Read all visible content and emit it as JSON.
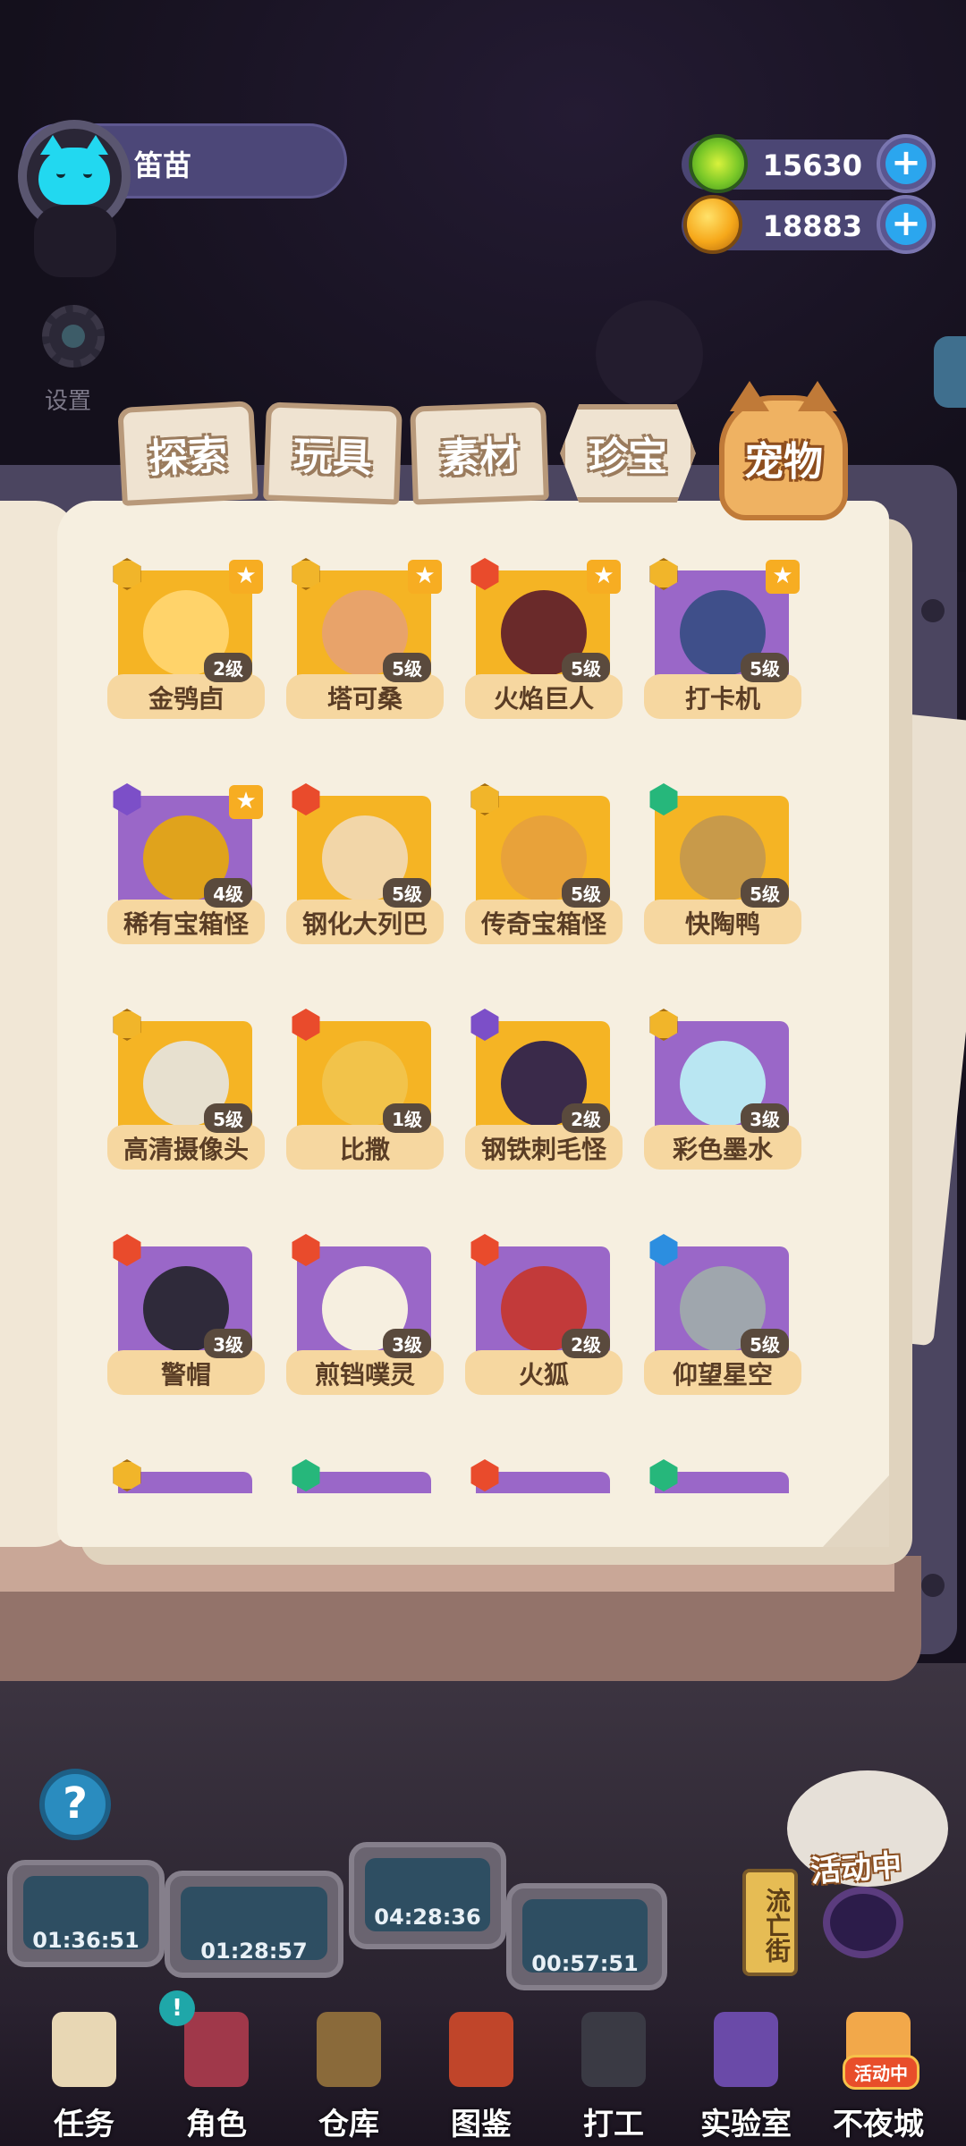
{
  "header": {
    "player_name": "笛苗",
    "settings_label": "设置",
    "currency": [
      {
        "icon": "green-gem-coin-icon",
        "value": "15630"
      },
      {
        "icon": "gold-planet-coin-icon",
        "value": "18883"
      }
    ]
  },
  "tabs": [
    {
      "label": "探索",
      "selected": false
    },
    {
      "label": "玩具",
      "selected": false
    },
    {
      "label": "素材",
      "selected": false
    },
    {
      "label": "珍宝",
      "selected": false
    },
    {
      "label": "宠物",
      "selected": true
    }
  ],
  "colors": {
    "gold": "#f5b424",
    "purple": "#9a67c8",
    "fire": "#e94b2c",
    "moon": "#7c4fc8",
    "green": "#26b77b",
    "water": "#2c8ee0"
  },
  "items": [
    {
      "name": "金鸮卣",
      "level": "2级",
      "element": "gold",
      "bg": "gold",
      "star": true
    },
    {
      "name": "塔可桑",
      "level": "5级",
      "element": "gold",
      "bg": "gold",
      "star": true
    },
    {
      "name": "火焰巨人",
      "level": "5级",
      "element": "fire",
      "bg": "gold",
      "star": true
    },
    {
      "name": "打卡机",
      "level": "5级",
      "element": "gold",
      "bg": "purple",
      "star": true
    },
    {
      "name": "稀有宝箱怪",
      "level": "4级",
      "element": "moon",
      "bg": "purple",
      "star": true
    },
    {
      "name": "钢化大列巴",
      "level": "5级",
      "element": "fire",
      "bg": "gold",
      "star": false
    },
    {
      "name": "传奇宝箱怪",
      "level": "5级",
      "element": "gold",
      "bg": "gold",
      "star": false
    },
    {
      "name": "快陶鸭",
      "level": "5级",
      "element": "green",
      "bg": "gold",
      "star": false
    },
    {
      "name": "高清摄像头",
      "level": "5级",
      "element": "gold",
      "bg": "gold",
      "star": false
    },
    {
      "name": "比撒",
      "level": "1级",
      "element": "fire",
      "bg": "gold",
      "star": false
    },
    {
      "name": "钢铁刺毛怪",
      "level": "2级",
      "element": "moon",
      "bg": "gold",
      "star": false
    },
    {
      "name": "彩色墨水",
      "level": "3级",
      "element": "gold",
      "bg": "purple",
      "star": false
    },
    {
      "name": "警帽",
      "level": "3级",
      "element": "fire",
      "bg": "purple",
      "star": false
    },
    {
      "name": "煎铛噗灵",
      "level": "3级",
      "element": "fire",
      "bg": "purple",
      "star": false
    },
    {
      "name": "火狐",
      "level": "2级",
      "element": "fire",
      "bg": "purple",
      "star": false
    },
    {
      "name": "仰望星空",
      "level": "5级",
      "element": "water",
      "bg": "purple",
      "star": false
    }
  ],
  "partial_row_elements": [
    "gold",
    "green",
    "fire",
    "green"
  ],
  "machines": [
    {
      "time": "01:36:51"
    },
    {
      "time": "01:28:57"
    },
    {
      "time": "04:28:36"
    },
    {
      "time": "00:57:51"
    }
  ],
  "street_sign": "流亡街",
  "event_label": "活动中",
  "nav": [
    {
      "label": "任务",
      "icon": "clipboard-icon"
    },
    {
      "label": "角色",
      "icon": "character-icon"
    },
    {
      "label": "仓库",
      "icon": "warehouse-icon"
    },
    {
      "label": "图鉴",
      "icon": "book-icon"
    },
    {
      "label": "打工",
      "icon": "work-icon"
    },
    {
      "label": "实验室",
      "icon": "lab-icon"
    },
    {
      "label": "不夜城",
      "icon": "city-icon"
    }
  ],
  "nav_event_badge": "活动中",
  "nav_new_badge": "!"
}
